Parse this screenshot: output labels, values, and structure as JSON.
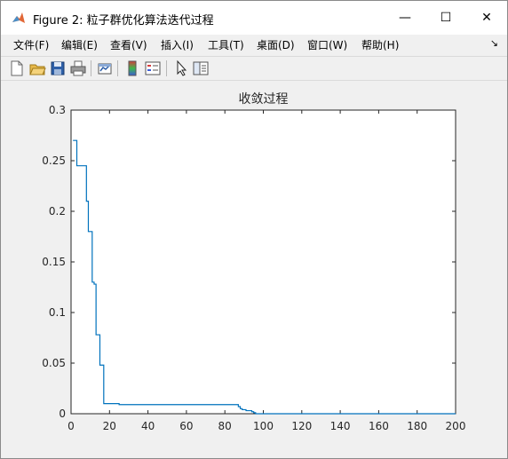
{
  "window": {
    "title": "Figure 2: 粒子群优化算法迭代过程",
    "minimize_glyph": "—",
    "maximize_glyph": "☐",
    "close_glyph": "✕"
  },
  "menu": {
    "items": [
      "文件(F)",
      "编辑(E)",
      "查看(V)",
      "插入(I)",
      "工具(T)",
      "桌面(D)",
      "窗口(W)",
      "帮助(H)"
    ],
    "overflow_glyph": "↘"
  },
  "toolbar": {
    "icons": [
      "new-figure-icon",
      "open-file-icon",
      "save-icon",
      "print-icon",
      "link-plot-icon",
      "insert-colorbar-icon",
      "insert-legend-icon",
      "edit-plot-icon",
      "property-inspector-icon"
    ]
  },
  "chart_data": {
    "type": "line",
    "title": "收敛过程",
    "xlabel": "",
    "ylabel": "",
    "xlim": [
      0,
      200
    ],
    "ylim": [
      0,
      0.3
    ],
    "xticks": [
      "0",
      "20",
      "40",
      "60",
      "80",
      "100",
      "120",
      "140",
      "160",
      "180",
      "200"
    ],
    "yticks": [
      "0",
      "0.05",
      "0.1",
      "0.15",
      "0.2",
      "0.25",
      "0.3"
    ],
    "grid": false,
    "line_color": "#0072bd",
    "series": [
      {
        "x": [
          1,
          2,
          3,
          4,
          5,
          6,
          7,
          8,
          9,
          10,
          11,
          12,
          13,
          14,
          15,
          16,
          17,
          18,
          19,
          20,
          25,
          30,
          40,
          50,
          60,
          70,
          80,
          86,
          87,
          88,
          89,
          90,
          91,
          92,
          93,
          94,
          95,
          96,
          100,
          120,
          140,
          160,
          180,
          200
        ],
        "y": [
          0.27,
          0.27,
          0.245,
          0.245,
          0.245,
          0.245,
          0.245,
          0.21,
          0.18,
          0.18,
          0.13,
          0.128,
          0.078,
          0.078,
          0.048,
          0.048,
          0.01,
          0.01,
          0.01,
          0.01,
          0.009,
          0.009,
          0.009,
          0.009,
          0.009,
          0.009,
          0.009,
          0.009,
          0.007,
          0.005,
          0.004,
          0.004,
          0.003,
          0.003,
          0.003,
          0.002,
          0.001,
          0.0,
          0.0,
          0.0,
          0.0,
          0.0,
          0.0,
          0.0
        ]
      }
    ]
  }
}
